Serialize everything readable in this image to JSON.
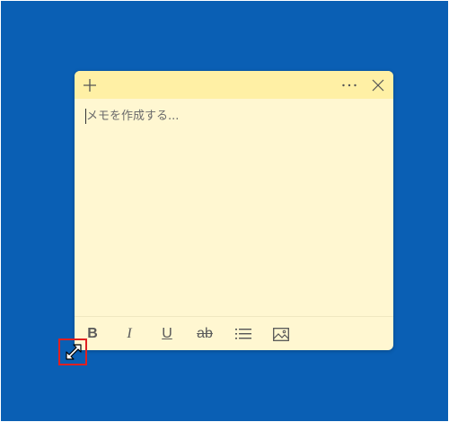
{
  "note": {
    "placeholder": "メモを作成する...",
    "colors": {
      "desktop": "#0a5fb4",
      "note_body": "#fff7d1",
      "note_titlebar": "#fff0a5",
      "highlight": "#e02020"
    }
  },
  "titlebar": {
    "add_icon": "plus-icon",
    "more_icon": "ellipsis-icon",
    "close_icon": "close-icon"
  },
  "toolbar": {
    "bold_label": "B",
    "italic_label": "I",
    "underline_label": "U",
    "strikethrough_label": "ab",
    "list_icon": "bulleted-list-icon",
    "image_icon": "image-icon"
  },
  "cursor": {
    "icon": "diagonal-resize-cursor-icon"
  }
}
